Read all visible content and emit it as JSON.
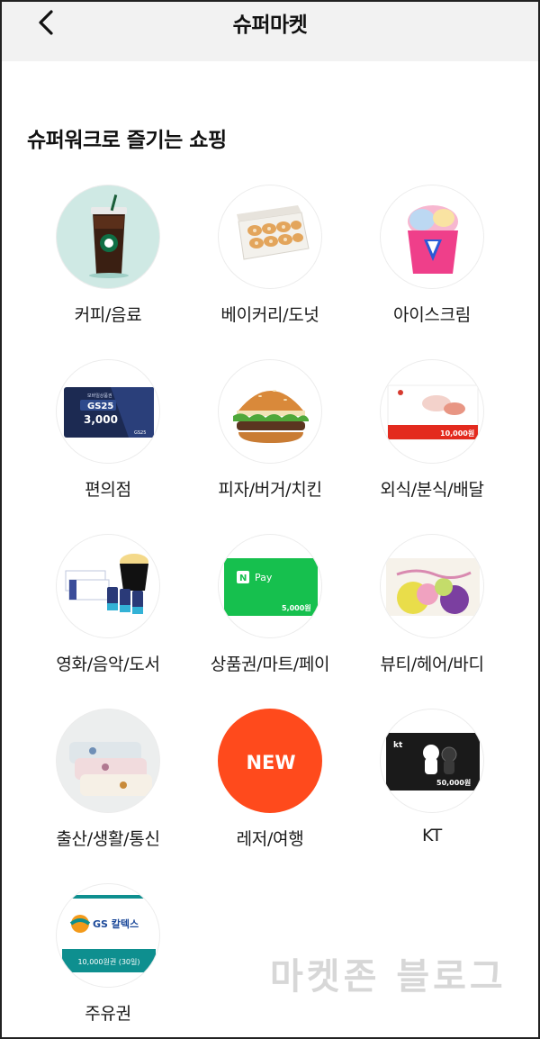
{
  "header": {
    "title": "슈퍼마켓",
    "back_icon": "chevron-left-icon"
  },
  "section": {
    "title": "슈퍼워크로 즐기는 쇼핑"
  },
  "categories": [
    {
      "label": "커피/음료",
      "icon": "coffee-drink-icon"
    },
    {
      "label": "베이커리/도넛",
      "icon": "donut-box-icon"
    },
    {
      "label": "아이스크림",
      "icon": "ice-cream-cup-icon"
    },
    {
      "label": "편의점",
      "icon": "convenience-store-card-icon",
      "card_title": "GS25",
      "card_sub": "모바일상품권",
      "card_value": "3,000",
      "card_foot": "GS25"
    },
    {
      "label": "피자/버거/치킨",
      "icon": "burger-icon"
    },
    {
      "label": "외식/분식/배달",
      "icon": "dining-voucher-icon",
      "card_value": "10,000원"
    },
    {
      "label": "영화/음악/도서",
      "icon": "movie-ticket-popcorn-icon"
    },
    {
      "label": "상품권/마트/페이",
      "icon": "npay-card-icon",
      "card_title": "Pay",
      "card_value": "5,000원"
    },
    {
      "label": "뷰티/헤어/바디",
      "icon": "beauty-card-icon"
    },
    {
      "label": "출산/생활/통신",
      "icon": "towels-icon"
    },
    {
      "label": "레저/여행",
      "icon": "new-badge-icon",
      "badge": "NEW"
    },
    {
      "label": "KT",
      "icon": "kt-card-icon",
      "card_title": "kt",
      "card_value": "50,000원"
    },
    {
      "label": "주유권",
      "icon": "gs-caltex-card-icon",
      "card_title": "GS 칼텍스",
      "card_value": "10,000원권 (30일)"
    }
  ],
  "watermark": "마켓존 블로그",
  "colors": {
    "header_bg": "#f2f2f2",
    "new_badge": "#ff4a1c",
    "npay_green": "#16c04e",
    "gs_teal": "#0e8f8f",
    "kt_black": "#1a1a1a"
  }
}
